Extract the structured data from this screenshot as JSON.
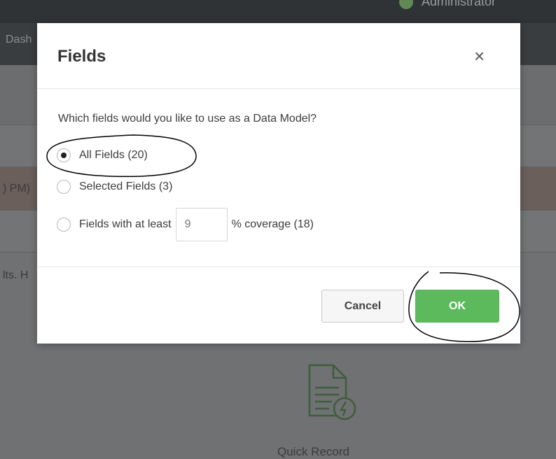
{
  "background": {
    "header_user": "Administrator",
    "nav_partial_label": "Dash",
    "row_partial_time": ") PM)",
    "row_partial_text": "lts. H",
    "caption_partial": "Quick Record"
  },
  "modal": {
    "title": "Fields",
    "close_icon": "×",
    "question": "Which fields would you like to use as a Data Model?",
    "options": [
      {
        "label": "All Fields (20)",
        "selected": true
      },
      {
        "label": "Selected Fields (3)",
        "selected": false
      },
      {
        "label_before": "Fields with at least",
        "input_placeholder": "9",
        "label_after": "% coverage (18)",
        "selected": false
      }
    ],
    "cancel_label": "Cancel",
    "ok_label": "OK"
  },
  "colors": {
    "ok_button": "#5cba5c",
    "overlay": "#6f7173",
    "annotation_ink": "#000000"
  },
  "icons": [
    "close-icon",
    "document-lightning-icon"
  ]
}
